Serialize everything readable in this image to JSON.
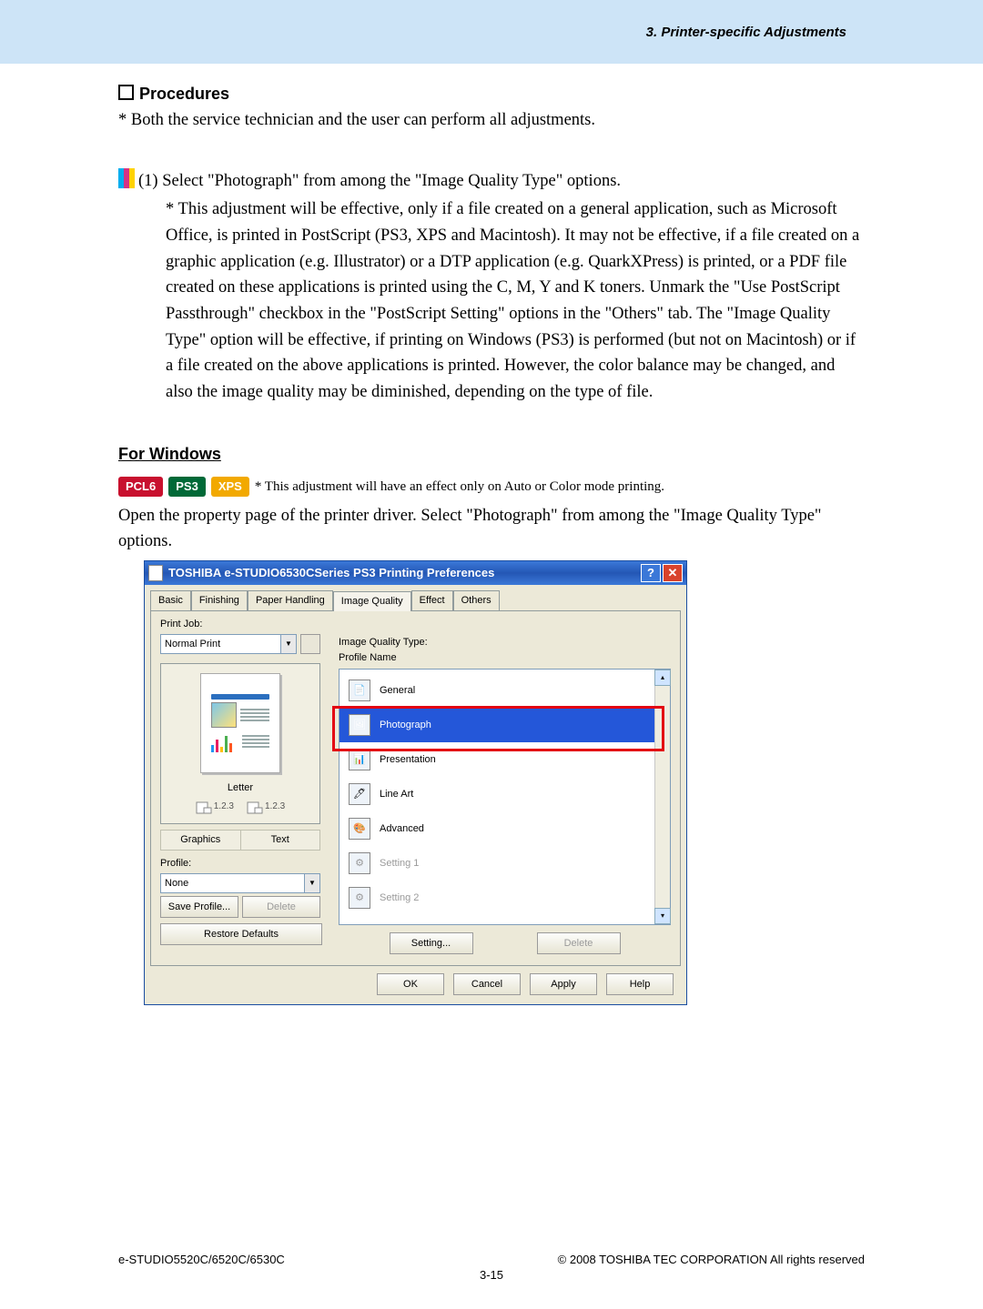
{
  "header": {
    "section": "3. Printer-specific Adjustments"
  },
  "procedures": {
    "heading": "Procedures",
    "note1": "* Both the service technician and the user can perform all adjustments.",
    "step1": "(1)  Select \"Photograph\" from among the \"Image Quality Type\" options.",
    "star_block": "* This adjustment will be effective, only if a file created on a general application, such as Microsoft Office, is printed in PostScript (PS3, XPS and Macintosh).  It may not be effective, if a file created on a graphic application (e.g. Illustrator) or a DTP application (e.g. QuarkXPress) is printed, or a PDF file created on these applications is printed using the C, M, Y and K toners.  Unmark the \"Use PostScript Passthrough\" checkbox in the \"PostScript Setting\" options in the \"Others\" tab.  The \"Image Quality Type\" option will be effective, if printing on Windows (PS3) is performed (but not on Macintosh) or if a file created on the above applications is printed.  However, the color balance may be changed, and also the image quality may be diminished, depending on the type of file."
  },
  "for_windows": {
    "heading": "For Windows",
    "badges": {
      "pcl6": "PCL6",
      "ps3": "PS3",
      "xps": "XPS"
    },
    "badge_note": "* This adjustment will have an effect only on Auto or Color mode printing.",
    "open_text": "Open the property page of the printer driver.  Select \"Photograph\" from among the \"Image Quality Type\" options."
  },
  "dialog": {
    "title": "TOSHIBA e-STUDIO6530CSeries PS3 Printing Preferences",
    "tabs": [
      "Basic",
      "Finishing",
      "Paper Handling",
      "Image Quality",
      "Effect",
      "Others"
    ],
    "active_tab": 3,
    "print_job_label": "Print Job:",
    "print_job_value": "Normal Print",
    "preview_caption": "Letter",
    "orient_a": "1.2.3",
    "orient_b": "1.2.3",
    "graphics": "Graphics",
    "text": "Text",
    "profile_label": "Profile:",
    "profile_value": "None",
    "save_profile": "Save Profile...",
    "delete_profile": "Delete",
    "restore_defaults": "Restore Defaults",
    "iq_type_label": "Image Quality Type:",
    "profile_name_label": "Profile Name",
    "iq_items": [
      {
        "label": "General",
        "disabled": false
      },
      {
        "label": "Photograph",
        "disabled": false,
        "selected": true
      },
      {
        "label": "Presentation",
        "disabled": false
      },
      {
        "label": "Line Art",
        "disabled": false
      },
      {
        "label": "Advanced",
        "disabled": false
      },
      {
        "label": "Setting 1",
        "disabled": true
      },
      {
        "label": "Setting 2",
        "disabled": true
      }
    ],
    "setting_btn": "Setting...",
    "delete_btn": "Delete",
    "ok": "OK",
    "cancel": "Cancel",
    "apply": "Apply",
    "help": "Help"
  },
  "footer": {
    "left": "e-STUDIO5520C/6520C/6530C",
    "right": "© 2008 TOSHIBA TEC CORPORATION All rights reserved",
    "page": "3-15"
  }
}
